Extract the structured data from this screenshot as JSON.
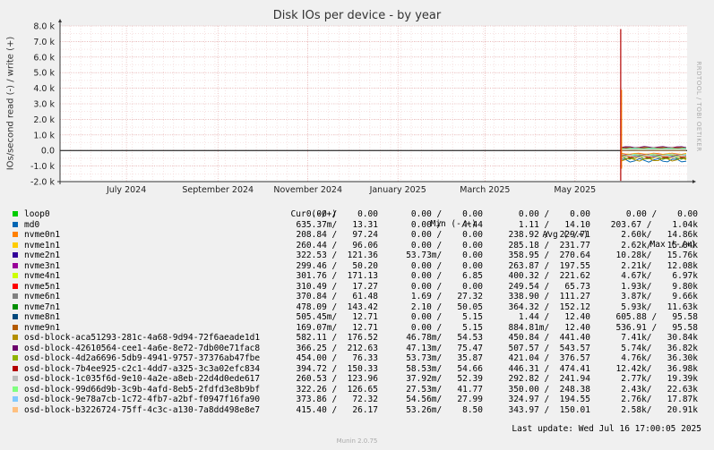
{
  "chart_data": {
    "type": "line",
    "title": "Disk IOs per device - by year",
    "ylabel": "IOs/second read (-) / write (+)",
    "ylim": [
      -2000,
      8000
    ],
    "yticks": [
      {
        "v": 8000,
        "label": "8.0 k"
      },
      {
        "v": 7000,
        "label": "7.0 k"
      },
      {
        "v": 6000,
        "label": "6.0 k"
      },
      {
        "v": 5000,
        "label": "5.0 k"
      },
      {
        "v": 4000,
        "label": "4.0 k"
      },
      {
        "v": 3000,
        "label": "3.0 k"
      },
      {
        "v": 2000,
        "label": "2.0 k"
      },
      {
        "v": 1000,
        "label": "1.0 k"
      },
      {
        "v": 0,
        "label": "0.0"
      },
      {
        "v": -1000,
        "label": "-1.0 k"
      },
      {
        "v": -2000,
        "label": "-2.0 k"
      }
    ],
    "xticks": [
      {
        "t": "2024-07-01",
        "label": "July 2024"
      },
      {
        "t": "2024-09-01",
        "label": "September 2024"
      },
      {
        "t": "2024-11-01",
        "label": "November 2024"
      },
      {
        "t": "2025-01-01",
        "label": "January 2025"
      },
      {
        "t": "2025-03-01",
        "label": "March 2025"
      },
      {
        "t": "2025-05-01",
        "label": "May 2025"
      }
    ],
    "xrange": [
      "2024-05-17",
      "2025-07-16"
    ],
    "grid": true,
    "data_start": "2025-06-01",
    "spike": {
      "t": "2025-06-01",
      "write_max": 7800,
      "read_min": -1950
    },
    "series": [
      {
        "name": "loop0",
        "color": "#00cc00",
        "write": 0,
        "read": 0
      },
      {
        "name": "md0",
        "color": "#0066b3",
        "write": 13,
        "read": -635
      },
      {
        "name": "nvme0n1",
        "color": "#ff8000",
        "write": 97,
        "read": -209
      },
      {
        "name": "nvme1n1",
        "color": "#ffcc00",
        "write": 96,
        "read": -260
      },
      {
        "name": "nvme2n1",
        "color": "#330099",
        "write": 121,
        "read": -323
      },
      {
        "name": "nvme3n1",
        "color": "#990099",
        "write": 50,
        "read": -299
      },
      {
        "name": "nvme4n1",
        "color": "#ccff00",
        "write": 171,
        "read": -302
      },
      {
        "name": "nvme5n1",
        "color": "#ff0000",
        "write": 17,
        "read": -310
      },
      {
        "name": "nvme6n1",
        "color": "#808080",
        "write": 61,
        "read": -371
      },
      {
        "name": "nvme7n1",
        "color": "#008f00",
        "write": 143,
        "read": -478
      },
      {
        "name": "nvme8n1",
        "color": "#00487d",
        "write": 13,
        "read": -1
      },
      {
        "name": "nvme9n1",
        "color": "#b35a00",
        "write": 13,
        "read": 0
      },
      {
        "name": "osd-block-aca51293-281c-4a68-9d94-72f6aeade1d1",
        "color": "#b38f00",
        "write": 177,
        "read": -582
      },
      {
        "name": "osd-block-42610564-cee1-4a6e-8e72-7db00e71fac8",
        "color": "#6b006b",
        "write": 213,
        "read": -366
      },
      {
        "name": "osd-block-4d2a6696-5db9-4941-9757-37376ab47fbe",
        "color": "#8fb300",
        "write": 76,
        "read": -454
      },
      {
        "name": "osd-block-7b4ee925-c2c1-4dd7-a325-3c3a02efc834",
        "color": "#b30000",
        "write": 150,
        "read": -395
      },
      {
        "name": "osd-block-1c035f6d-9e10-4a2e-a8eb-22d4d0ede617",
        "color": "#bebebe",
        "write": 124,
        "read": -261
      },
      {
        "name": "osd-block-99d66d9b-3c9b-4afd-8eb5-2fdfd3e8b9bf",
        "color": "#80ff80",
        "write": 127,
        "read": -322
      },
      {
        "name": "osd-block-9e78a7cb-1c72-4fb7-a2bf-f0947f16fa90",
        "color": "#80c9ff",
        "write": 72,
        "read": -374
      },
      {
        "name": "osd-block-b3226724-75ff-4c3c-a130-7a8dd498e8e7",
        "color": "#ffc080",
        "write": 26,
        "read": -415
      }
    ]
  },
  "legend": {
    "headers": {
      "cur": "Cur (-/+)",
      "min": "Min (-/+)",
      "avg": "Avg (-/+)",
      "max": "Max (-/+)"
    },
    "rows": [
      {
        "name": "loop0",
        "cur": "0.00 /    0.00",
        "min": "0.00 /    0.00",
        "avg": "0.00 /    0.00",
        "max": "0.00 /    0.00"
      },
      {
        "name": "md0",
        "cur": "635.37m/   13.31",
        "min": "0.00 /    4.44",
        "avg": "1.11 /   14.10",
        "max": "203.67 /    1.04k"
      },
      {
        "name": "nvme0n1",
        "cur": "208.84 /   97.24",
        "min": "0.00 /    0.00",
        "avg": "238.92 /  229.71",
        "max": "2.60k/   14.86k"
      },
      {
        "name": "nvme1n1",
        "cur": "260.44 /   96.06",
        "min": "0.00 /    0.00",
        "avg": "285.18 /  231.77",
        "max": "2.62k/   15.84k"
      },
      {
        "name": "nvme2n1",
        "cur": "322.53 /  121.36",
        "min": "53.73m/    0.00",
        "avg": "358.95 /  270.64",
        "max": "10.28k/   15.76k"
      },
      {
        "name": "nvme3n1",
        "cur": "299.46 /   50.20",
        "min": "0.00 /    0.00",
        "avg": "263.87 /  197.55",
        "max": "2.21k/   12.08k"
      },
      {
        "name": "nvme4n1",
        "cur": "301.76 /  171.13",
        "min": "0.00 /    6.85",
        "avg": "400.32 /  221.62",
        "max": "4.67k/    6.97k"
      },
      {
        "name": "nvme5n1",
        "cur": "310.49 /   17.27",
        "min": "0.00 /    0.00",
        "avg": "249.54 /   65.73",
        "max": "1.93k/    9.80k"
      },
      {
        "name": "nvme6n1",
        "cur": "370.84 /   61.48",
        "min": "1.69 /   27.32",
        "avg": "338.90 /  111.27",
        "max": "3.87k/    9.66k"
      },
      {
        "name": "nvme7n1",
        "cur": "478.09 /  143.42",
        "min": "2.10 /   50.05",
        "avg": "364.32 /  152.12",
        "max": "5.93k/   11.63k"
      },
      {
        "name": "nvme8n1",
        "cur": "505.45m/   12.71",
        "min": "0.00 /    5.15",
        "avg": "1.44 /   12.40",
        "max": "605.88 /   95.58"
      },
      {
        "name": "nvme9n1",
        "cur": "169.07m/   12.71",
        "min": "0.00 /    5.15",
        "avg": "884.81m/   12.40",
        "max": "536.91 /   95.58"
      },
      {
        "name": "osd-block-aca51293-281c-4a68-9d94-72f6aeade1d1",
        "cur": "582.11 /  176.52",
        "min": "46.78m/   54.53",
        "avg": "450.84 /  441.40",
        "max": "7.41k/   30.84k"
      },
      {
        "name": "osd-block-42610564-cee1-4a6e-8e72-7db00e71fac8",
        "cur": "366.25 /  212.63",
        "min": "47.13m/   75.47",
        "avg": "507.57 /  543.57",
        "max": "5.74k/   36.82k"
      },
      {
        "name": "osd-block-4d2a6696-5db9-4941-9757-37376ab47fbe",
        "cur": "454.00 /   76.33",
        "min": "53.73m/   35.87",
        "avg": "421.04 /  376.57",
        "max": "4.76k/   36.30k"
      },
      {
        "name": "osd-block-7b4ee925-c2c1-4dd7-a325-3c3a02efc834",
        "cur": "394.72 /  150.33",
        "min": "58.53m/   54.66",
        "avg": "446.31 /  474.41",
        "max": "12.42k/   36.98k"
      },
      {
        "name": "osd-block-1c035f6d-9e10-4a2e-a8eb-22d4d0ede617",
        "cur": "260.53 /  123.96",
        "min": "37.92m/   52.39",
        "avg": "292.82 /  241.94",
        "max": "2.77k/   19.39k"
      },
      {
        "name": "osd-block-99d66d9b-3c9b-4afd-8eb5-2fdfd3e8b9bf",
        "cur": "322.26 /  126.65",
        "min": "27.53m/   41.77",
        "avg": "350.00 /  248.38",
        "max": "2.43k/   22.63k"
      },
      {
        "name": "osd-block-9e78a7cb-1c72-4fb7-a2bf-f0947f16fa90",
        "cur": "373.86 /   72.32",
        "min": "54.56m/   27.99",
        "avg": "324.97 /  194.55",
        "max": "2.76k/   17.87k"
      },
      {
        "name": "osd-block-b3226724-75ff-4c3c-a130-7a8dd498e8e7",
        "cur": "415.40 /   26.17",
        "min": "53.26m/    8.50",
        "avg": "343.97 /  150.01",
        "max": "2.58k/   20.91k"
      }
    ]
  },
  "last_update": "Last update: Wed Jul 16 17:00:05 2025",
  "watermark": "RRDTOOL / TOBI OETIKER",
  "munin_version": "Munin 2.0.75"
}
